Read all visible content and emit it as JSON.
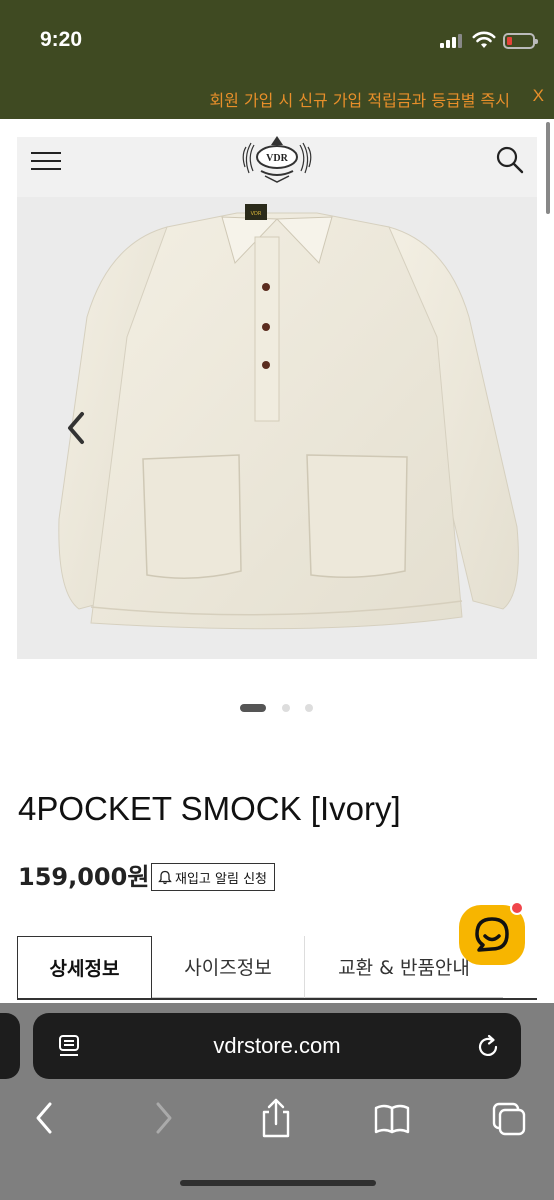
{
  "status_bar": {
    "time": "9:20"
  },
  "banner": {
    "text": "회원 가입 시 신규 가입 적립금과 등급별 즉시",
    "close": "X"
  },
  "header": {
    "logo_text": "VDR"
  },
  "product": {
    "name": "4POCKET SMOCK [Ivory]",
    "price": "159,000원",
    "restock_label": "재입고 알림 신청",
    "label_text": "VDR"
  },
  "gallery": {
    "current": 1,
    "total": 3
  },
  "tabs": [
    {
      "label": "상세정보",
      "active": true
    },
    {
      "label": "사이즈정보",
      "active": false
    },
    {
      "label": "교환 & 반품안내",
      "active": false
    }
  ],
  "browser": {
    "url": "vdrstore.com"
  },
  "colors": {
    "banner_bg": "#3f4a22",
    "banner_text": "#e88f2a",
    "chat_button": "#f7b500",
    "badge": "#f0454b"
  }
}
